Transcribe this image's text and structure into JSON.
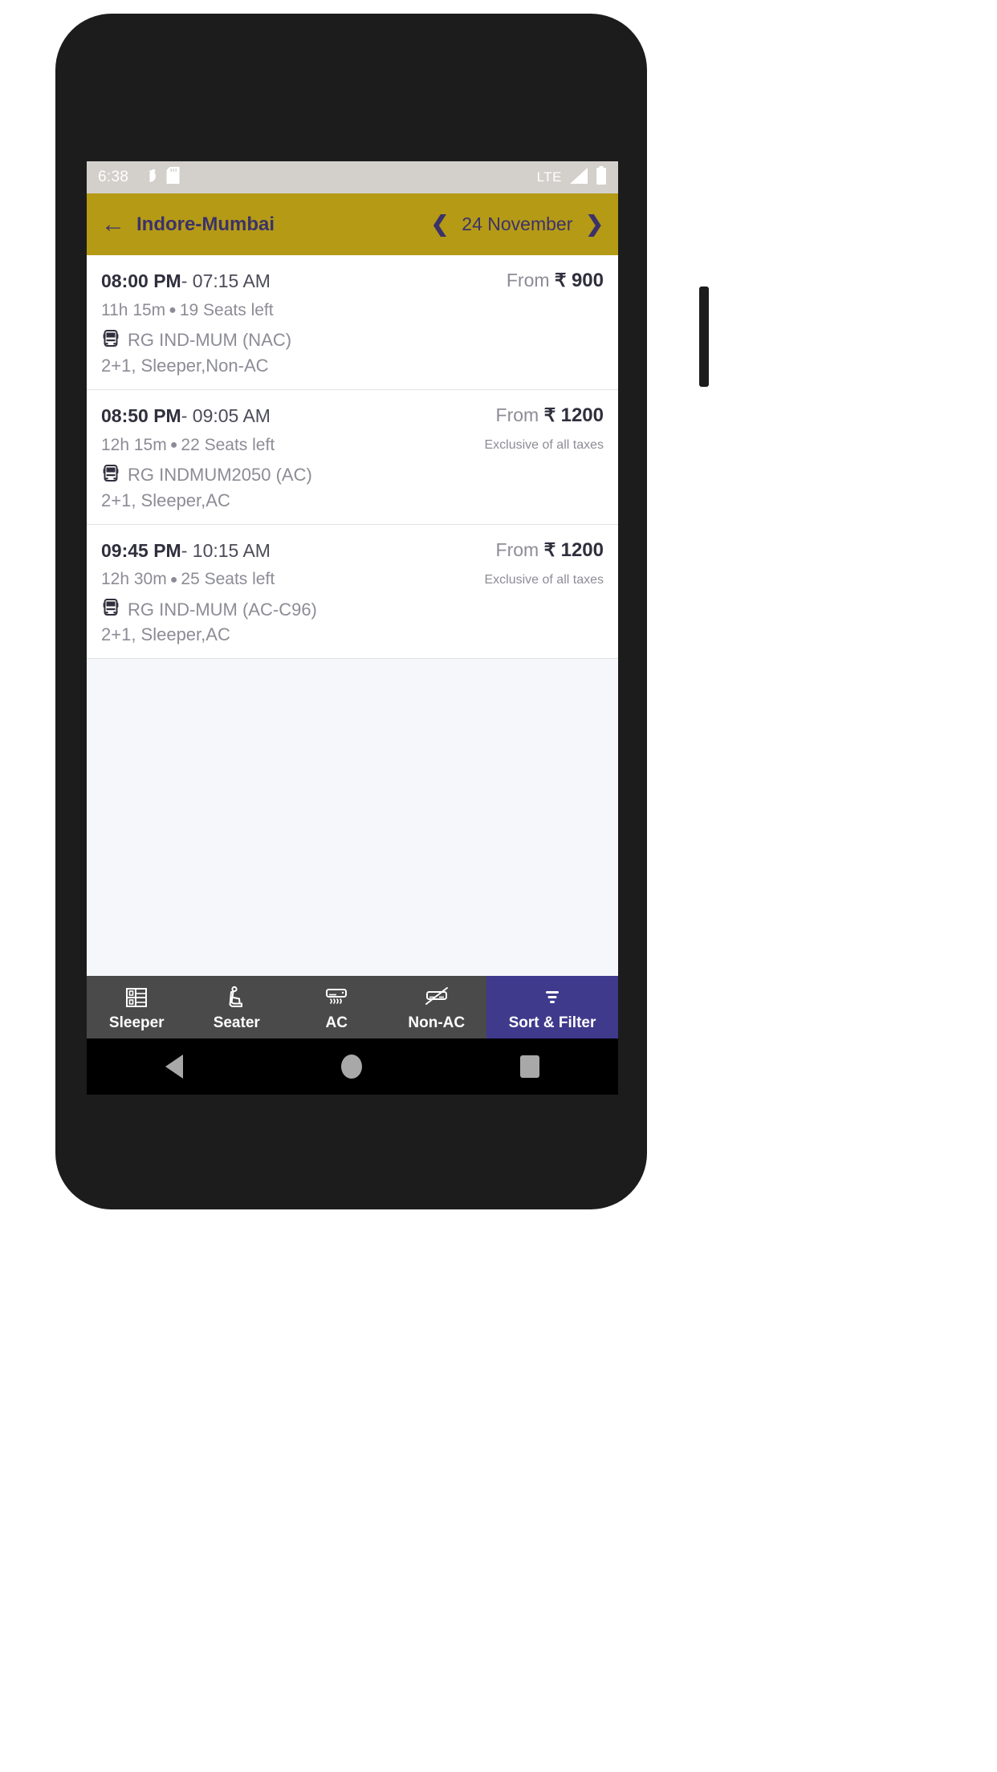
{
  "status_bar": {
    "time": "6:38",
    "left_icons": [
      "alarm-icon",
      "sd-card-icon"
    ],
    "network": "LTE",
    "right_icons": [
      "signal-icon",
      "battery-icon"
    ],
    "background": "#d3d0cb"
  },
  "app_bar": {
    "back_icon": "back-arrow-icon",
    "title": "Indore-Mumbai",
    "prev_icon": "chevron-left-icon",
    "date": "24 November",
    "next_icon": "chevron-right-icon",
    "background": "#b59a16",
    "text_color": "#3b3269"
  },
  "buses": [
    {
      "departure": "08:00 PM",
      "separator": "-",
      "arrival": "07:15 AM",
      "duration": "11h 15m",
      "seats": "19 Seats left",
      "bus_icon": "bus-icon",
      "operator": "RG IND-MUM (NAC)",
      "seat_config": "2+1, Sleeper,Non-AC",
      "price_prefix": "From",
      "currency": "₹",
      "price": "900",
      "tax_note": ""
    },
    {
      "departure": "08:50 PM",
      "separator": "-",
      "arrival": "09:05 AM",
      "duration": "12h 15m",
      "seats": "22 Seats left",
      "bus_icon": "bus-icon",
      "operator": "RG INDMUM2050 (AC)",
      "seat_config": "2+1, Sleeper,AC",
      "price_prefix": "From",
      "currency": "₹",
      "price": "1200",
      "tax_note": "Exclusive of all taxes"
    },
    {
      "departure": "09:45 PM",
      "separator": "-",
      "arrival": "10:15 AM",
      "duration": "12h 30m",
      "seats": "25 Seats left",
      "bus_icon": "bus-icon",
      "operator": "RG IND-MUM (AC-C96)",
      "seat_config": "2+1, Sleeper,AC",
      "price_prefix": "From",
      "currency": "₹",
      "price": "1200",
      "tax_note": "Exclusive of all taxes"
    }
  ],
  "filter_bar": {
    "background": "#4a4a4a",
    "accent_background": "#3f3a8c",
    "items": [
      {
        "label": "Sleeper",
        "icon": "bunk-bed-icon"
      },
      {
        "label": "Seater",
        "icon": "seat-icon"
      },
      {
        "label": "AC",
        "icon": "air-conditioner-icon"
      },
      {
        "label": "Non-AC",
        "icon": "air-conditioner-off-icon"
      },
      {
        "label": "Sort & Filter",
        "icon": "filter-icon"
      }
    ]
  },
  "nav_bar": {
    "back_icon": "nav-back-icon",
    "home_icon": "nav-home-icon",
    "recent_icon": "nav-recent-icon"
  }
}
